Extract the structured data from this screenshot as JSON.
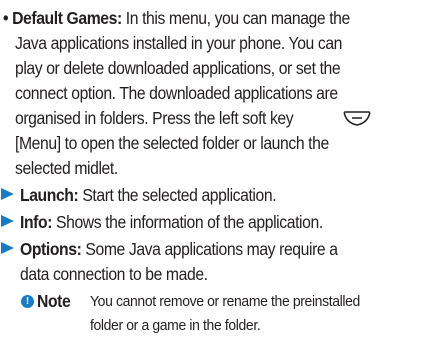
{
  "default_games": {
    "bullet": "•",
    "heading": "Default Games:",
    "line1_rest": " In this menu, you can manage the",
    "line2": "Java applications installed in your phone. You can",
    "line3": "play or delete downloaded applications, or set the",
    "line4": "connect option. The downloaded applications are",
    "line5_start": "organised in folders. Press the left soft key",
    "line6": "[Menu] to open the selected folder or launch the",
    "line7": "selected midlet.",
    "softkey_icon": "left-soft-key-icon"
  },
  "items": [
    {
      "label": "Launch:",
      "text": " Start the selected application."
    },
    {
      "label": "Info:",
      "text": " Shows the information of the application."
    },
    {
      "label": "Options:",
      "text": " Some Java applications may require a"
    }
  ],
  "options_continuation": "data connection to be made.",
  "note": {
    "icon_glyph": "!",
    "icon_name": "note-icon",
    "label": "Note",
    "line1": "You cannot remove or rename the preinstalled",
    "line2": "folder or a game in the folder."
  },
  "colors": {
    "text": "#231f20",
    "accent": "#1a7bc0"
  }
}
